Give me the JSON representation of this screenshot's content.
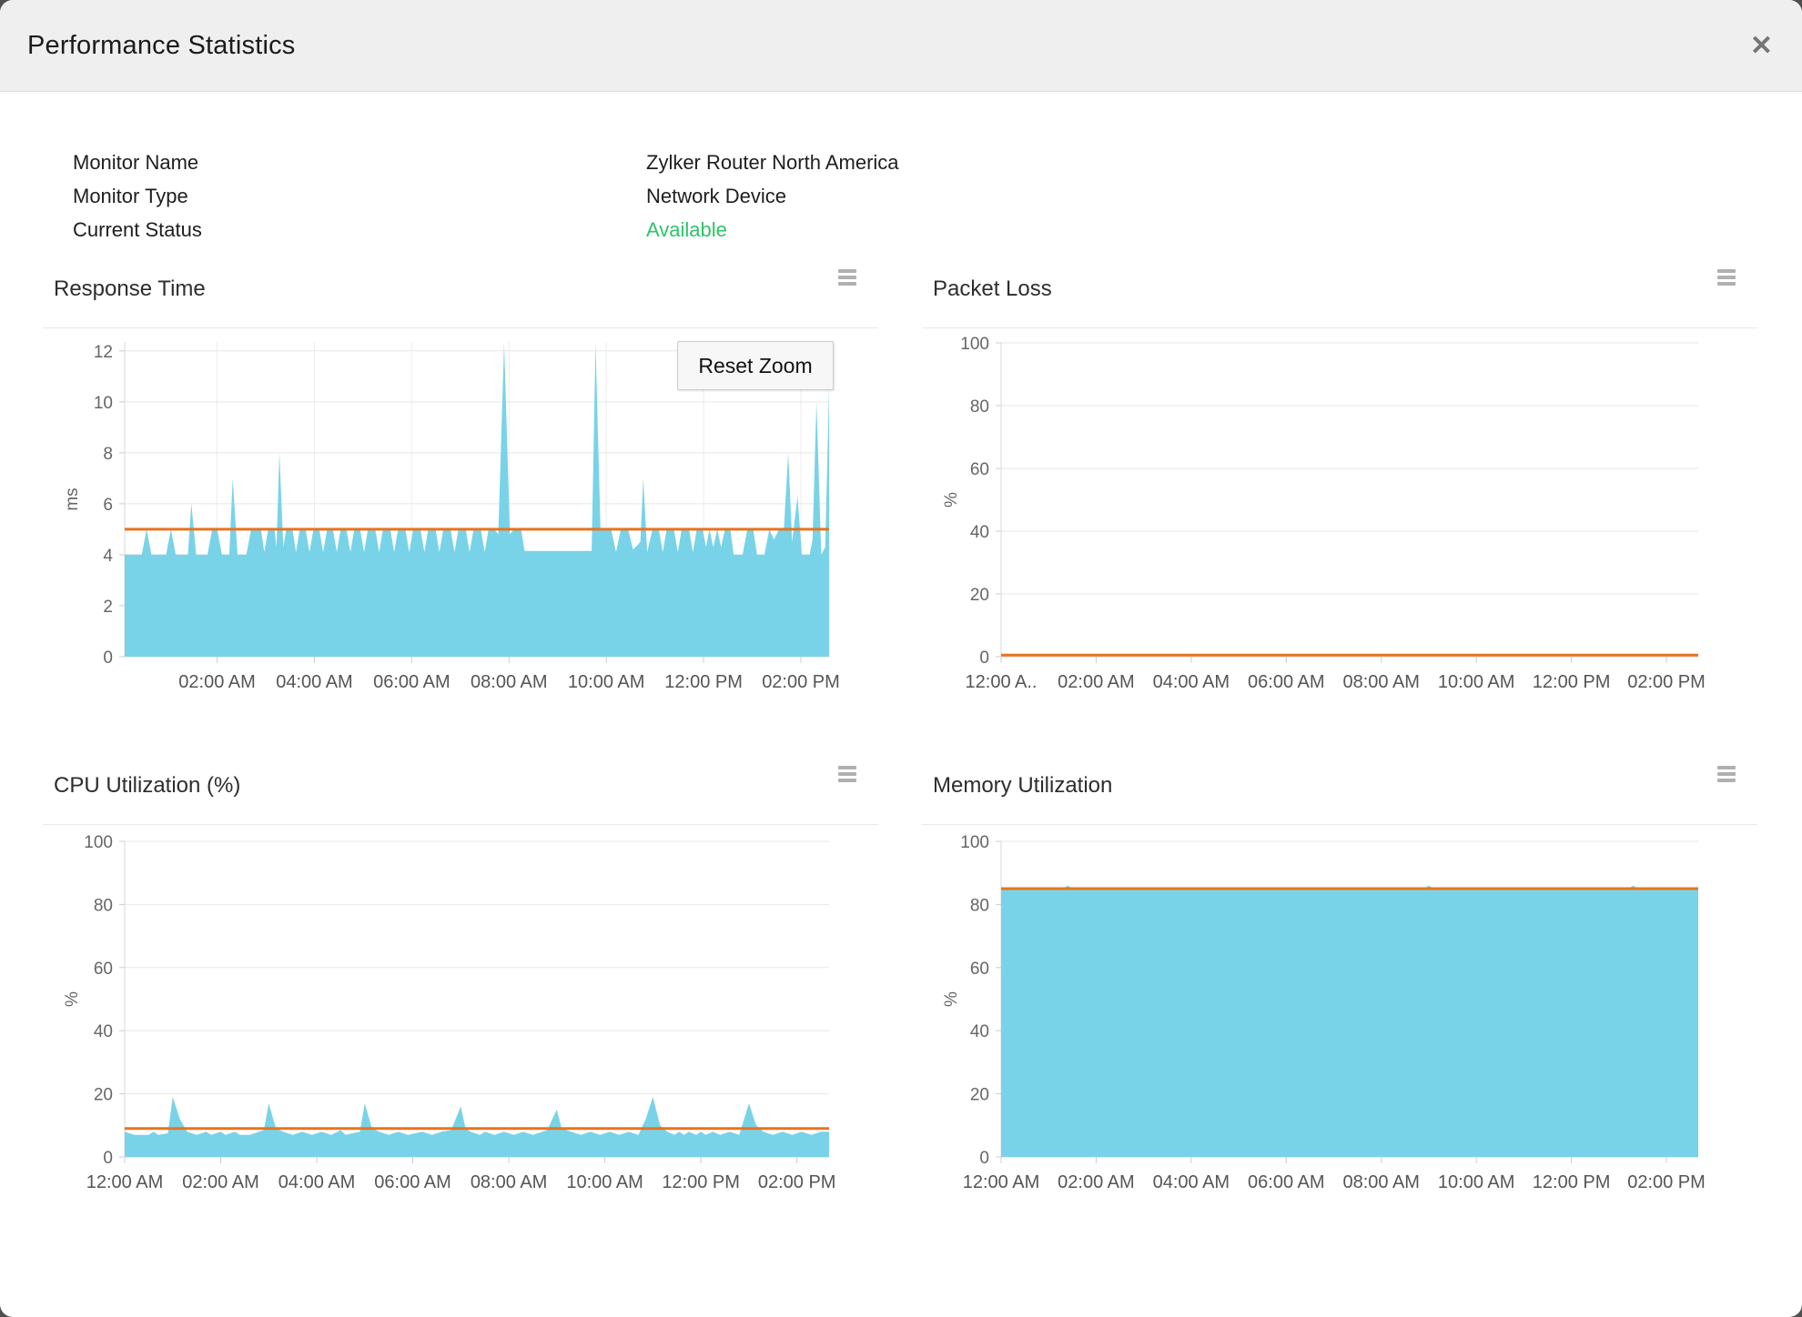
{
  "dialog": {
    "title": "Performance Statistics",
    "close_icon": "✕"
  },
  "info": {
    "rows": [
      {
        "label": "Monitor Name",
        "value": "Zylker Router North America"
      },
      {
        "label": "Monitor Type",
        "value": "Network Device"
      },
      {
        "label": "Current Status",
        "value": "Available"
      }
    ],
    "status_color": "#2ec36a"
  },
  "reset_zoom_label": "Reset Zoom",
  "colors": {
    "area": "#79D3E8",
    "threshold": "#E8731E",
    "grid": "#E7E7E7",
    "vgrid": "#EDEDED",
    "axis": "#D8D8D8",
    "tick": "#CCCCCC",
    "tick_text": "#666666"
  },
  "chart_data": {
    "response_time": {
      "type": "area",
      "title": "Response Time",
      "ylabel": "ms",
      "ymin": 0,
      "ymax": 12.35,
      "yticks": [
        0,
        2,
        4,
        6,
        8,
        10,
        12
      ],
      "x_range": [
        0.1,
        14.58
      ],
      "xticks": [
        {
          "t": 2,
          "label": "02:00 AM"
        },
        {
          "t": 4,
          "label": "04:00 AM"
        },
        {
          "t": 6,
          "label": "06:00 AM"
        },
        {
          "t": 8,
          "label": "08:00 AM"
        },
        {
          "t": 10,
          "label": "10:00 AM"
        },
        {
          "t": 12,
          "label": "12:00 PM"
        },
        {
          "t": 14,
          "label": "02:00 PM"
        }
      ],
      "threshold": 5,
      "zoomed": true,
      "series": [
        [
          0.1,
          4
        ],
        [
          0.45,
          4
        ],
        [
          0.55,
          5
        ],
        [
          0.65,
          4
        ],
        [
          0.95,
          4
        ],
        [
          1.05,
          5
        ],
        [
          1.15,
          4
        ],
        [
          1.4,
          4
        ],
        [
          1.47,
          6
        ],
        [
          1.57,
          4
        ],
        [
          1.8,
          4
        ],
        [
          1.9,
          5
        ],
        [
          2.0,
          5
        ],
        [
          2.1,
          4
        ],
        [
          2.25,
          4
        ],
        [
          2.32,
          7
        ],
        [
          2.42,
          4
        ],
        [
          2.6,
          4
        ],
        [
          2.7,
          5
        ],
        [
          2.9,
          5
        ],
        [
          2.97,
          4.1
        ],
        [
          3.05,
          5
        ],
        [
          3.18,
          5
        ],
        [
          3.22,
          4.3
        ],
        [
          3.28,
          8
        ],
        [
          3.36,
          4.3
        ],
        [
          3.42,
          5
        ],
        [
          3.55,
          5
        ],
        [
          3.62,
          4.1
        ],
        [
          3.7,
          5
        ],
        [
          3.82,
          5
        ],
        [
          3.9,
          4.1
        ],
        [
          3.98,
          5
        ],
        [
          4.1,
          5
        ],
        [
          4.18,
          4.1
        ],
        [
          4.26,
          5
        ],
        [
          4.38,
          5
        ],
        [
          4.46,
          4.1
        ],
        [
          4.54,
          5
        ],
        [
          4.66,
          5
        ],
        [
          4.74,
          4.1
        ],
        [
          4.82,
          5
        ],
        [
          4.94,
          5
        ],
        [
          5.02,
          4.1
        ],
        [
          5.1,
          5
        ],
        [
          5.25,
          5
        ],
        [
          5.33,
          4.1
        ],
        [
          5.41,
          5
        ],
        [
          5.56,
          5
        ],
        [
          5.64,
          4.1
        ],
        [
          5.72,
          5
        ],
        [
          5.87,
          5
        ],
        [
          5.95,
          4.1
        ],
        [
          6.03,
          5
        ],
        [
          6.18,
          5
        ],
        [
          6.26,
          4.1
        ],
        [
          6.34,
          5
        ],
        [
          6.49,
          5
        ],
        [
          6.57,
          4.1
        ],
        [
          6.65,
          5
        ],
        [
          6.8,
          5
        ],
        [
          6.88,
          4.1
        ],
        [
          6.96,
          5
        ],
        [
          7.11,
          5
        ],
        [
          7.19,
          4.1
        ],
        [
          7.27,
          5
        ],
        [
          7.42,
          5
        ],
        [
          7.5,
          4.1
        ],
        [
          7.58,
          5
        ],
        [
          7.7,
          5
        ],
        [
          7.78,
          4.8
        ],
        [
          7.9,
          12.3
        ],
        [
          8.02,
          4.8
        ],
        [
          8.1,
          5
        ],
        [
          8.25,
          5
        ],
        [
          8.32,
          4.15
        ],
        [
          9.7,
          4.15
        ],
        [
          9.78,
          12.3
        ],
        [
          9.88,
          5
        ],
        [
          10.1,
          5
        ],
        [
          10.2,
          4.1
        ],
        [
          10.3,
          5
        ],
        [
          10.45,
          5
        ],
        [
          10.55,
          4.2
        ],
        [
          10.7,
          4.5
        ],
        [
          10.76,
          7
        ],
        [
          10.84,
          4.1
        ],
        [
          10.95,
          5
        ],
        [
          11.08,
          5
        ],
        [
          11.16,
          4.1
        ],
        [
          11.24,
          5
        ],
        [
          11.39,
          5
        ],
        [
          11.47,
          4.1
        ],
        [
          11.55,
          5
        ],
        [
          11.7,
          5
        ],
        [
          11.78,
          4.1
        ],
        [
          11.86,
          5
        ],
        [
          11.98,
          5
        ],
        [
          12.05,
          4.3
        ],
        [
          12.12,
          5
        ],
        [
          12.2,
          4.3
        ],
        [
          12.28,
          5
        ],
        [
          12.36,
          4.3
        ],
        [
          12.44,
          5
        ],
        [
          12.55,
          5
        ],
        [
          12.62,
          4
        ],
        [
          12.8,
          4
        ],
        [
          12.9,
          5
        ],
        [
          13.02,
          5
        ],
        [
          13.1,
          4
        ],
        [
          13.25,
          4
        ],
        [
          13.35,
          5
        ],
        [
          13.45,
          4.6
        ],
        [
          13.55,
          5
        ],
        [
          13.65,
          5
        ],
        [
          13.74,
          8
        ],
        [
          13.82,
          4.5
        ],
        [
          13.93,
          6.3
        ],
        [
          14.02,
          4
        ],
        [
          14.18,
          4
        ],
        [
          14.24,
          4.6
        ],
        [
          14.32,
          10
        ],
        [
          14.42,
          4
        ],
        [
          14.5,
          4.3
        ],
        [
          14.58,
          10.6
        ]
      ]
    },
    "packet_loss": {
      "type": "area",
      "title": "Packet Loss",
      "ylabel": "%",
      "ymin": 0,
      "ymax": 100,
      "yticks": [
        0,
        20,
        40,
        60,
        80,
        100
      ],
      "x_range": [
        0,
        14.67
      ],
      "xticks": [
        {
          "t": 0,
          "label": "12:00 A.."
        },
        {
          "t": 2,
          "label": "02:00 AM"
        },
        {
          "t": 4,
          "label": "04:00 AM"
        },
        {
          "t": 6,
          "label": "06:00 AM"
        },
        {
          "t": 8,
          "label": "08:00 AM"
        },
        {
          "t": 10,
          "label": "10:00 AM"
        },
        {
          "t": 12,
          "label": "12:00 PM"
        },
        {
          "t": 14,
          "label": "02:00 PM"
        }
      ],
      "threshold": 0.5,
      "series": [
        [
          0,
          0
        ],
        [
          14.67,
          0
        ]
      ]
    },
    "cpu": {
      "type": "area",
      "title": "CPU Utilization (%)",
      "ylabel": "%",
      "ymin": 0,
      "ymax": 100,
      "yticks": [
        0,
        20,
        40,
        60,
        80,
        100
      ],
      "x_range": [
        0,
        14.67
      ],
      "xticks": [
        {
          "t": 0,
          "label": "12:00 AM"
        },
        {
          "t": 2,
          "label": "02:00 AM"
        },
        {
          "t": 4,
          "label": "04:00 AM"
        },
        {
          "t": 6,
          "label": "06:00 AM"
        },
        {
          "t": 8,
          "label": "08:00 AM"
        },
        {
          "t": 10,
          "label": "10:00 AM"
        },
        {
          "t": 12,
          "label": "12:00 PM"
        },
        {
          "t": 14,
          "label": "02:00 PM"
        }
      ],
      "threshold": 9,
      "series": [
        [
          0,
          8
        ],
        [
          0.2,
          7
        ],
        [
          0.5,
          7
        ],
        [
          0.6,
          8
        ],
        [
          0.7,
          7
        ],
        [
          0.9,
          7.5
        ],
        [
          1.0,
          19
        ],
        [
          1.15,
          12
        ],
        [
          1.3,
          8
        ],
        [
          1.5,
          7
        ],
        [
          1.7,
          8
        ],
        [
          1.8,
          7
        ],
        [
          2.0,
          8
        ],
        [
          2.1,
          7
        ],
        [
          2.3,
          8
        ],
        [
          2.4,
          7
        ],
        [
          2.6,
          7
        ],
        [
          2.9,
          8.5
        ],
        [
          3.0,
          17
        ],
        [
          3.15,
          9
        ],
        [
          3.3,
          8
        ],
        [
          3.5,
          7
        ],
        [
          3.7,
          8
        ],
        [
          3.9,
          7
        ],
        [
          4.1,
          8
        ],
        [
          4.3,
          7
        ],
        [
          4.5,
          8.5
        ],
        [
          4.6,
          7
        ],
        [
          4.9,
          8
        ],
        [
          5.0,
          17
        ],
        [
          5.15,
          9
        ],
        [
          5.3,
          8
        ],
        [
          5.5,
          7
        ],
        [
          5.7,
          8
        ],
        [
          5.9,
          7
        ],
        [
          6.2,
          8
        ],
        [
          6.4,
          7
        ],
        [
          6.6,
          8
        ],
        [
          6.8,
          8.5
        ],
        [
          7.0,
          16
        ],
        [
          7.1,
          9
        ],
        [
          7.2,
          8
        ],
        [
          7.4,
          7
        ],
        [
          7.5,
          8
        ],
        [
          7.7,
          7
        ],
        [
          7.9,
          8
        ],
        [
          8.1,
          7
        ],
        [
          8.3,
          8
        ],
        [
          8.5,
          7
        ],
        [
          8.8,
          8.5
        ],
        [
          9.0,
          15
        ],
        [
          9.1,
          9
        ],
        [
          9.3,
          8
        ],
        [
          9.5,
          7
        ],
        [
          9.7,
          8
        ],
        [
          9.9,
          7
        ],
        [
          10.1,
          8
        ],
        [
          10.3,
          7
        ],
        [
          10.5,
          8
        ],
        [
          10.7,
          7
        ],
        [
          10.85,
          12
        ],
        [
          11.0,
          19
        ],
        [
          11.15,
          10
        ],
        [
          11.3,
          8
        ],
        [
          11.45,
          7
        ],
        [
          11.55,
          8
        ],
        [
          11.65,
          7
        ],
        [
          11.75,
          8
        ],
        [
          11.9,
          7
        ],
        [
          12.0,
          8
        ],
        [
          12.1,
          7
        ],
        [
          12.25,
          8
        ],
        [
          12.4,
          7
        ],
        [
          12.6,
          8
        ],
        [
          12.8,
          7
        ],
        [
          13.0,
          17
        ],
        [
          13.15,
          10
        ],
        [
          13.3,
          8
        ],
        [
          13.5,
          7
        ],
        [
          13.7,
          8
        ],
        [
          13.9,
          7
        ],
        [
          14.1,
          8
        ],
        [
          14.3,
          7
        ],
        [
          14.5,
          8
        ],
        [
          14.67,
          8
        ]
      ]
    },
    "memory": {
      "type": "area",
      "title": "Memory Utilization",
      "ylabel": "%",
      "ymin": 0,
      "ymax": 100,
      "yticks": [
        0,
        20,
        40,
        60,
        80,
        100
      ],
      "x_range": [
        0,
        14.67
      ],
      "xticks": [
        {
          "t": 0,
          "label": "12:00 AM"
        },
        {
          "t": 2,
          "label": "02:00 AM"
        },
        {
          "t": 4,
          "label": "04:00 AM"
        },
        {
          "t": 6,
          "label": "06:00 AM"
        },
        {
          "t": 8,
          "label": "08:00 AM"
        },
        {
          "t": 10,
          "label": "10:00 AM"
        },
        {
          "t": 12,
          "label": "12:00 PM"
        },
        {
          "t": 14,
          "label": "02:00 PM"
        }
      ],
      "threshold": 85,
      "series": [
        [
          0,
          85
        ],
        [
          1.3,
          85
        ],
        [
          1.4,
          86
        ],
        [
          1.5,
          85
        ],
        [
          8.9,
          85
        ],
        [
          9.0,
          86
        ],
        [
          9.1,
          85
        ],
        [
          13.2,
          85
        ],
        [
          13.3,
          86
        ],
        [
          13.4,
          85
        ],
        [
          14.67,
          85
        ]
      ]
    }
  }
}
